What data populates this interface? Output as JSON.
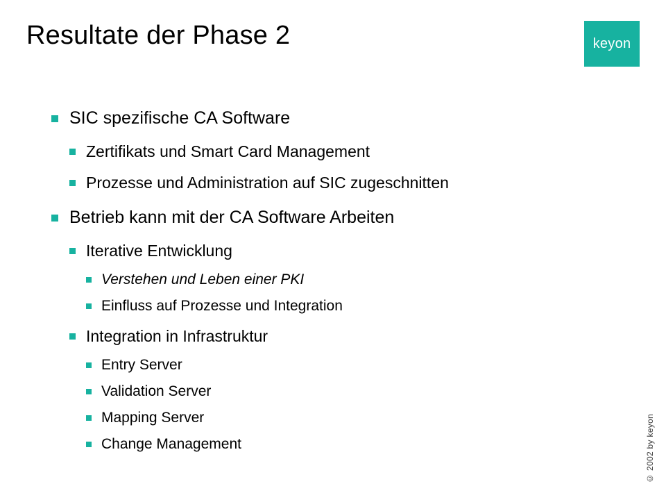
{
  "header": {
    "title": "Resultate der Phase 2",
    "logo": "keyon"
  },
  "bullets": [
    {
      "text": "SIC spezifische CA Software",
      "children": [
        {
          "text": "Zertifikats und Smart Card Management"
        },
        {
          "text": "Prozesse und Administration auf SIC zugeschnitten"
        }
      ]
    },
    {
      "text": "Betrieb kann mit der CA Software Arbeiten",
      "children": [
        {
          "text": "Iterative Entwicklung",
          "children": [
            {
              "text": "Verstehen und Leben einer PKI",
              "italic": true
            },
            {
              "text": "Einfluss auf Prozesse und Integration"
            }
          ]
        },
        {
          "text": "Integration in Infrastruktur",
          "children": [
            {
              "text": "Entry Server"
            },
            {
              "text": "Validation Server"
            },
            {
              "text": "Mapping Server"
            },
            {
              "text": "Change Management"
            }
          ]
        }
      ]
    }
  ],
  "footer": {
    "copyright": "© 2002 by keyon"
  }
}
